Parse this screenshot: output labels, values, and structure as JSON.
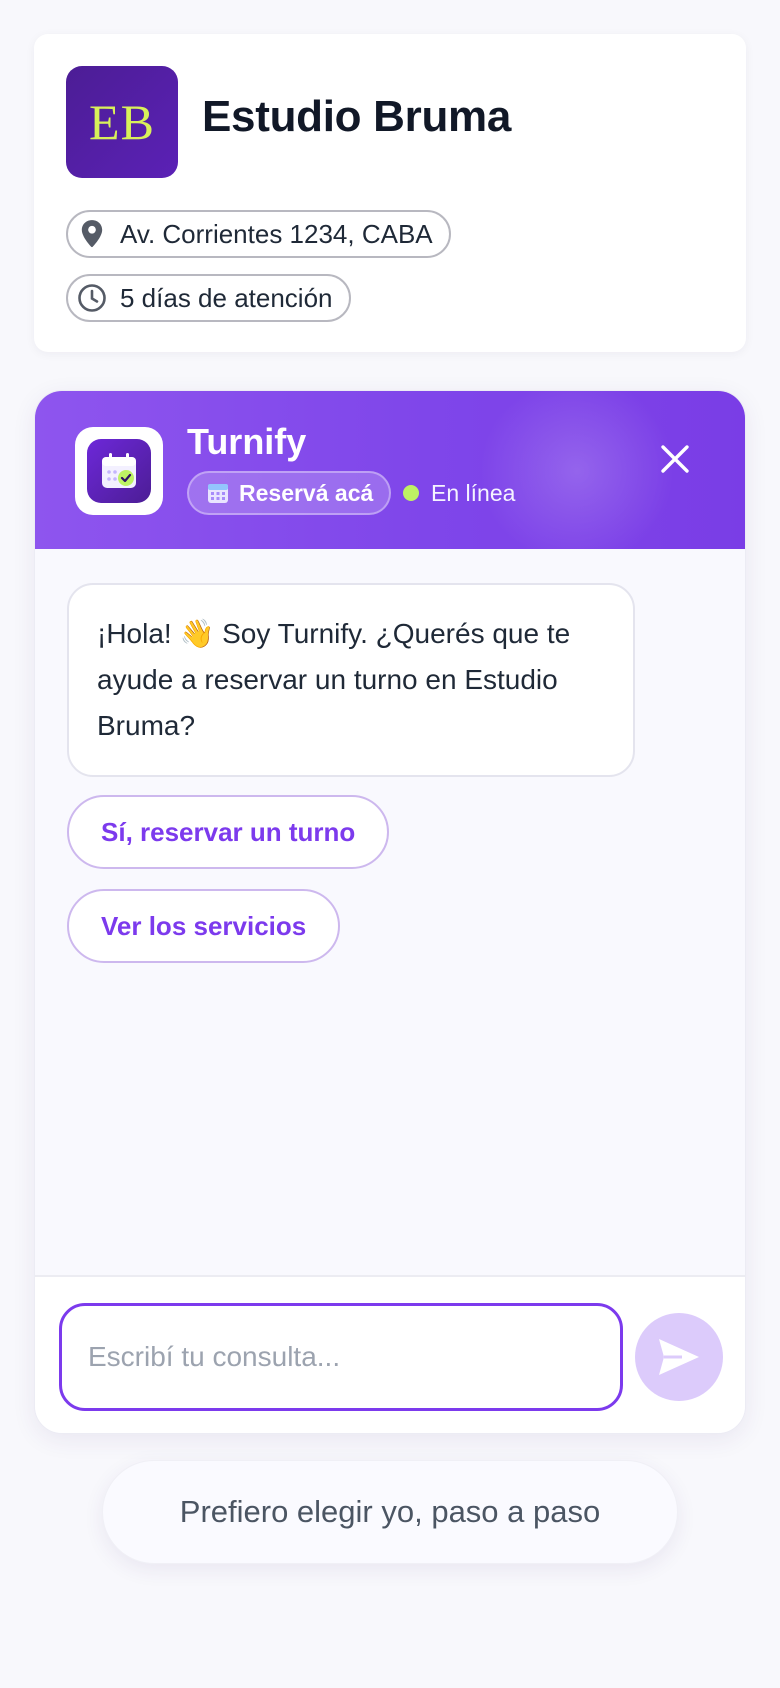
{
  "business": {
    "logo_text": "EB",
    "name": "Estudio Bruma",
    "address": "Av. Corrientes 1234, CABA",
    "hours": "5 días de atención",
    "address_icon": "map-pin-icon",
    "hours_icon": "clock-icon"
  },
  "chat": {
    "bot_name": "Turnify",
    "badge_label": "Reservá acá",
    "badge_icon": "calendar-icon",
    "status": "En línea",
    "status_color": "#bef264",
    "close_icon": "close-icon",
    "greeting_pre": "¡Hola! ",
    "greeting_emoji": "👋",
    "greeting_post": " Soy Turnify. ¿Querés que te ayude a reservar un turno en Estudio Bruma?",
    "quick_replies": [
      "Sí, reservar un turno",
      "Ver los servicios"
    ],
    "input_placeholder": "Escribí tu consulta...",
    "input_value": "",
    "send_icon": "send-icon"
  },
  "footer": {
    "step_by_step_label": "Prefiero elegir yo, paso a paso"
  },
  "colors": {
    "accent": "#7c3aed",
    "header_gradient_start": "#8e55ee",
    "logo_bg": "#4c1d95",
    "logo_text": "#d9f05a"
  }
}
